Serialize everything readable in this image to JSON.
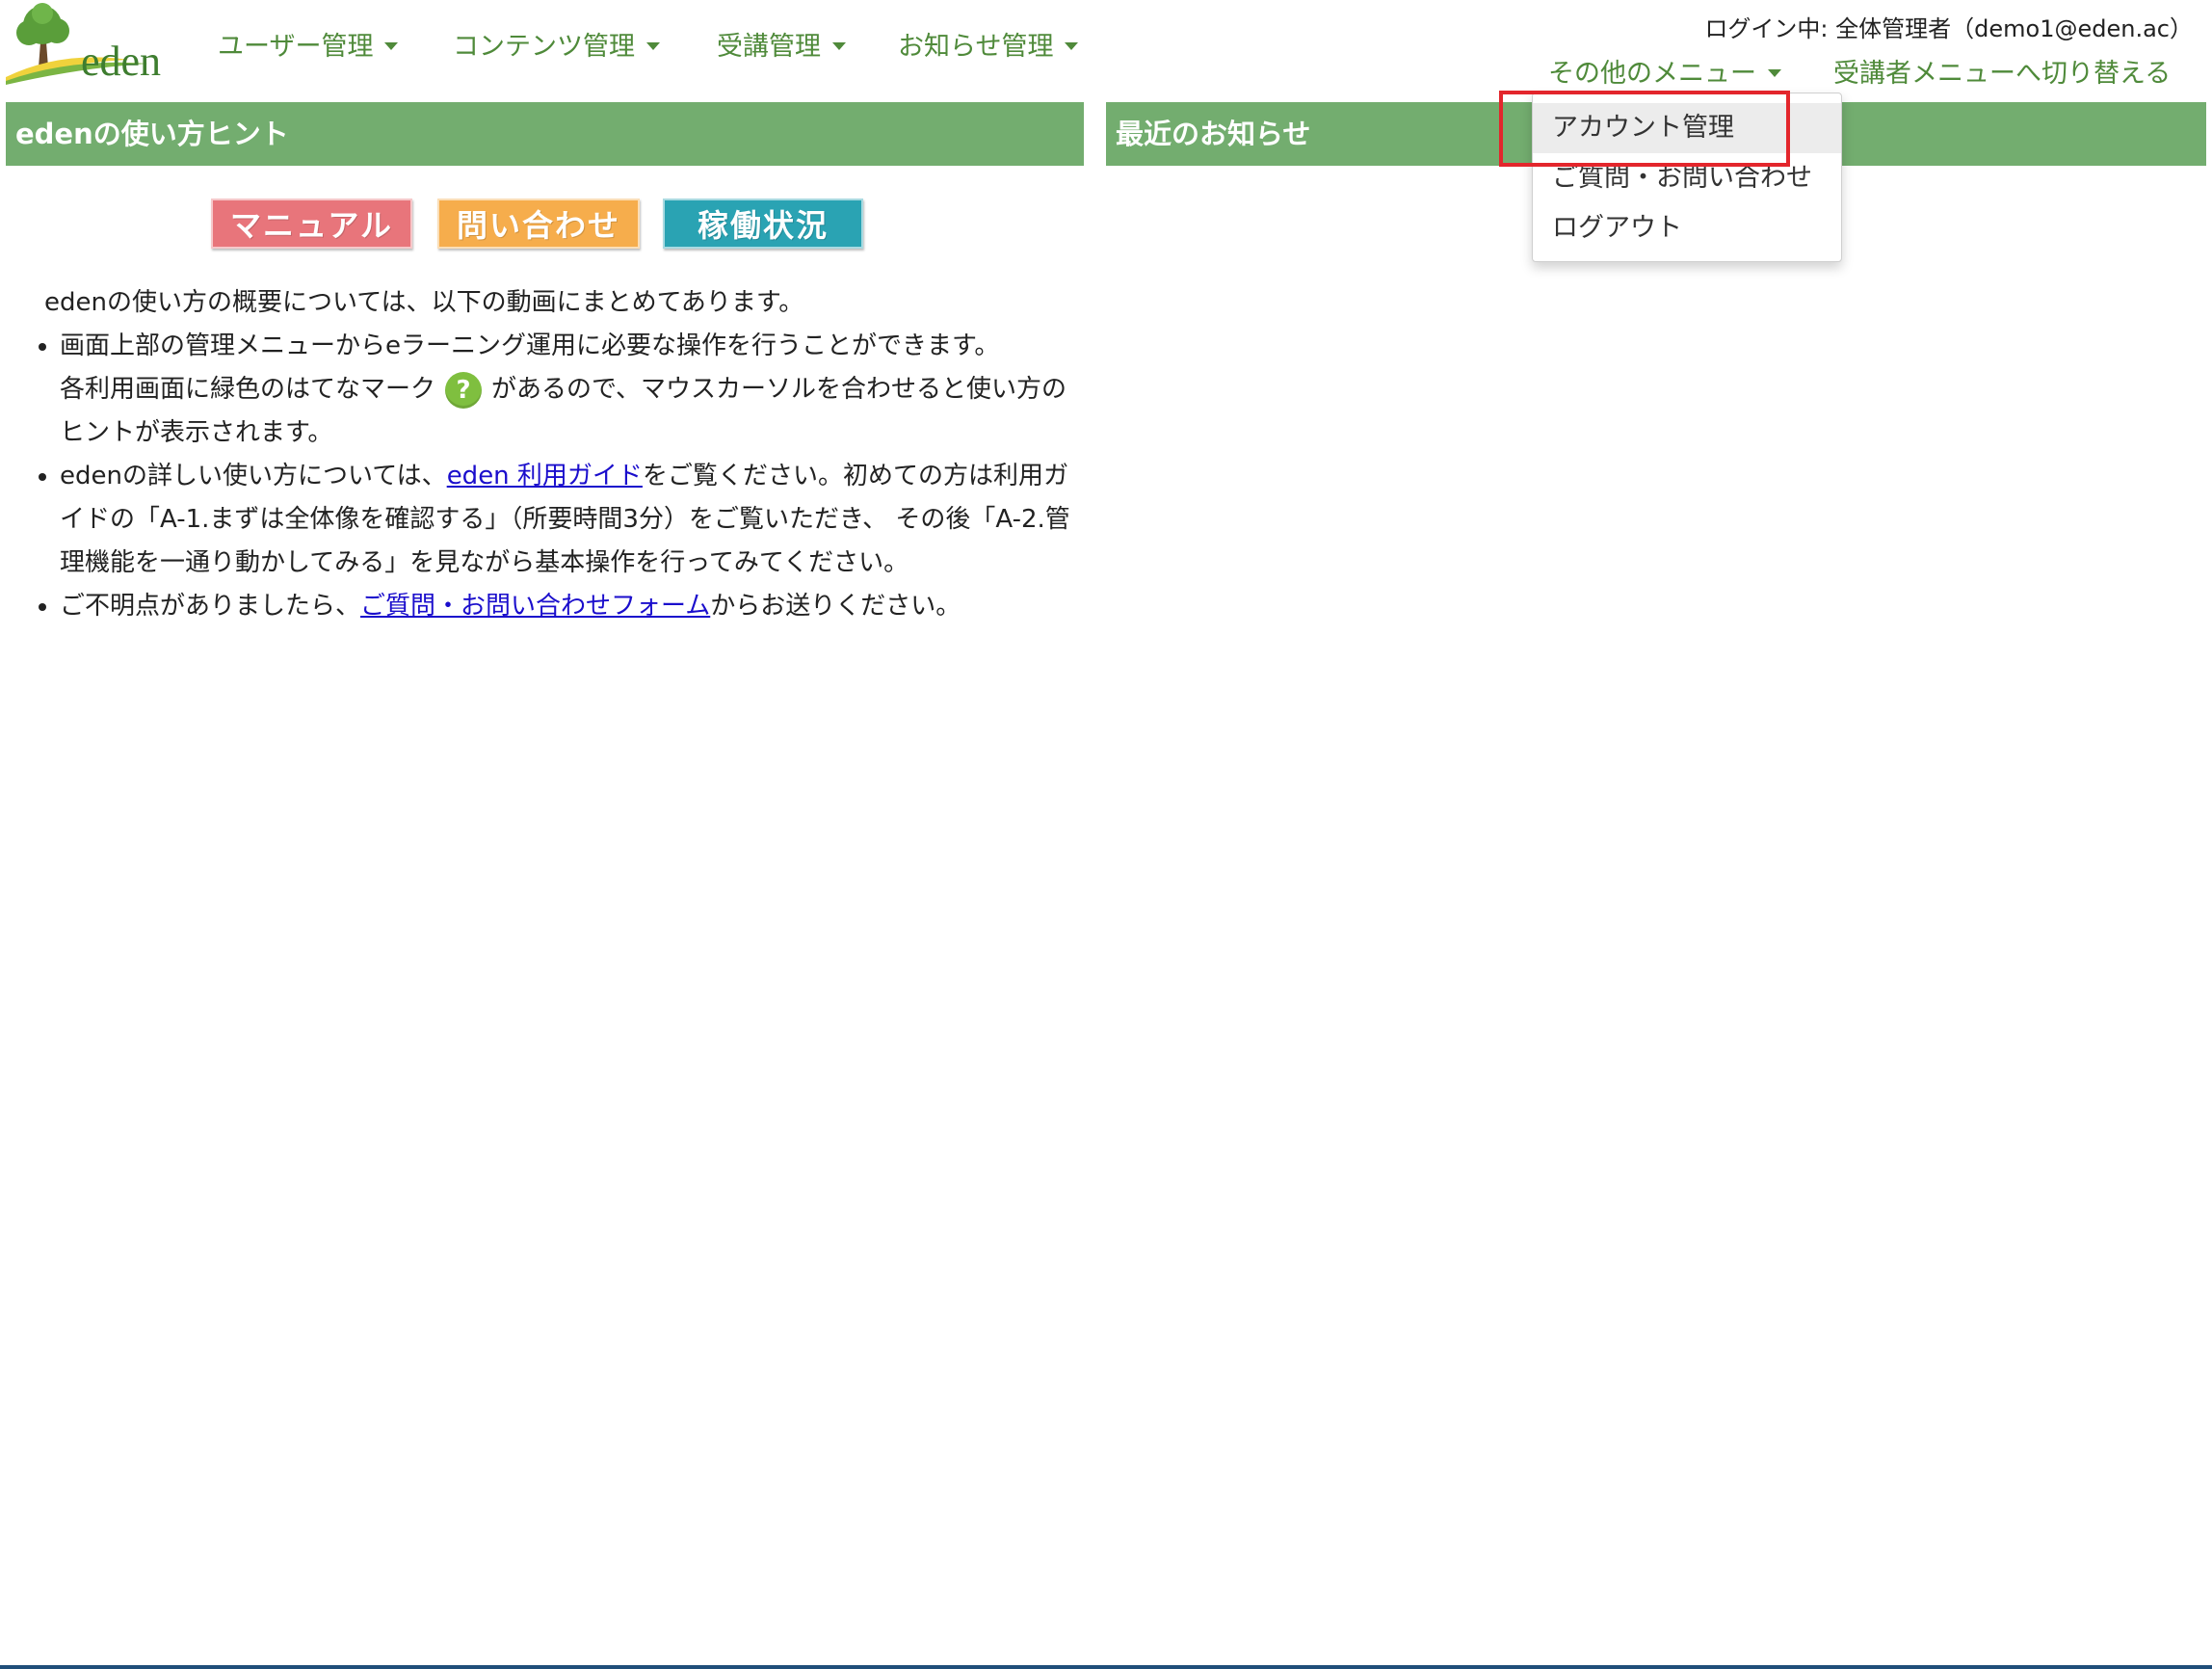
{
  "header": {
    "logo_text": "eden",
    "nav": [
      {
        "label": "ユーザー管理"
      },
      {
        "label": "コンテンツ管理"
      },
      {
        "label": "受講管理"
      },
      {
        "label": "お知らせ管理"
      }
    ],
    "login_info": "ログイン中: 全体管理者（demo1@eden.ac）",
    "other_menu_label": "その他のメニュー",
    "switch_label": "受講者メニューへ切り替える"
  },
  "left_panel": {
    "title": "edenの使い方ヒント",
    "buttons": [
      {
        "label": "マニュアル",
        "color": "#e8757b"
      },
      {
        "label": "問い合わせ",
        "color": "#f6ad4c"
      },
      {
        "label": "稼働状況",
        "color": "#2aa3b3"
      }
    ],
    "intro": "edenの使い方の概要については、以下の動画にまとめてあります。",
    "bullet1_line1": "画面上部の管理メニューからeラーニング運用に必要な操作を行うことができます。",
    "bullet1_line2a": "各利用画面に緑色のはてなマーク",
    "bullet1_line2b": "があるので、マウスカーソルを合わせると使い方のヒントが表示されます。",
    "help_icon_glyph": "?",
    "bullet2_pre": "edenの詳しい使い方については、",
    "bullet2_link": "eden 利用ガイド",
    "bullet2_post": "をご覧ください。初めての方は利用ガイドの「A-1.まずは全体像を確認する」（所要時間3分）をご覧いただき、 その後「A-2.管理機能を一通り動かしてみる」を見ながら基本操作を行ってみてください。",
    "bullet3_pre": "ご不明点がありましたら、",
    "bullet3_link": "ご質問・お問い合わせフォーム",
    "bullet3_post": "からお送りください。"
  },
  "right_panel": {
    "title": "最近のお知らせ"
  },
  "dropdown": {
    "items": [
      {
        "label": "アカウント管理"
      },
      {
        "label": "ご質問・お問い合わせ"
      },
      {
        "label": "ログアウト"
      }
    ]
  },
  "colors": {
    "panel_header": "#73ad6f",
    "nav_text": "#4f8a3a",
    "link": "#1a0dcc",
    "highlight": "#e3262c"
  }
}
